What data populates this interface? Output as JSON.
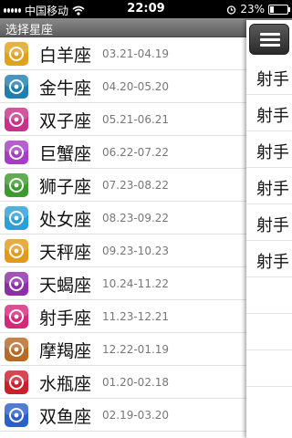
{
  "status_bar": {
    "carrier": "中国移动",
    "time": "22:09",
    "battery": "23%",
    "battery_level": 0.23,
    "icons": [
      "signal-icon",
      "wifi-icon",
      "alarm-icon",
      "battery-icon"
    ]
  },
  "header": {
    "title": "选择星座"
  },
  "zodiac": [
    {
      "name": "白羊座",
      "dates": "03.21-04.19",
      "color": "#e0a21c"
    },
    {
      "name": "金牛座",
      "dates": "04.20-05.20",
      "color": "#1f7fb2"
    },
    {
      "name": "双子座",
      "dates": "05.21-06.21",
      "color": "#c7338a"
    },
    {
      "name": "巨蟹座",
      "dates": "06.22-07.22",
      "color": "#a93cc4"
    },
    {
      "name": "狮子座",
      "dates": "07.23-08.22",
      "color": "#3c9a2e"
    },
    {
      "name": "处女座",
      "dates": "08.23-09.22",
      "color": "#2d9fd8"
    },
    {
      "name": "天秤座",
      "dates": "09.23-10.23",
      "color": "#e39a1b"
    },
    {
      "name": "天蝎座",
      "dates": "10.24-11.22",
      "color": "#8e2ea8"
    },
    {
      "name": "射手座",
      "dates": "11.23-12.21",
      "color": "#d6287a"
    },
    {
      "name": "摩羯座",
      "dates": "12.22-01.19",
      "color": "#b86a22"
    },
    {
      "name": "水瓶座",
      "dates": "01.20-02.18",
      "color": "#cc1f2c"
    },
    {
      "name": "双鱼座",
      "dates": "02.19-03.20",
      "color": "#2a61c9"
    }
  ],
  "right_panel": {
    "menu_icon": "menu-icon",
    "items": [
      "射手",
      "射手",
      "射手",
      "射手",
      "射手",
      "射手",
      "",
      "",
      ""
    ]
  }
}
